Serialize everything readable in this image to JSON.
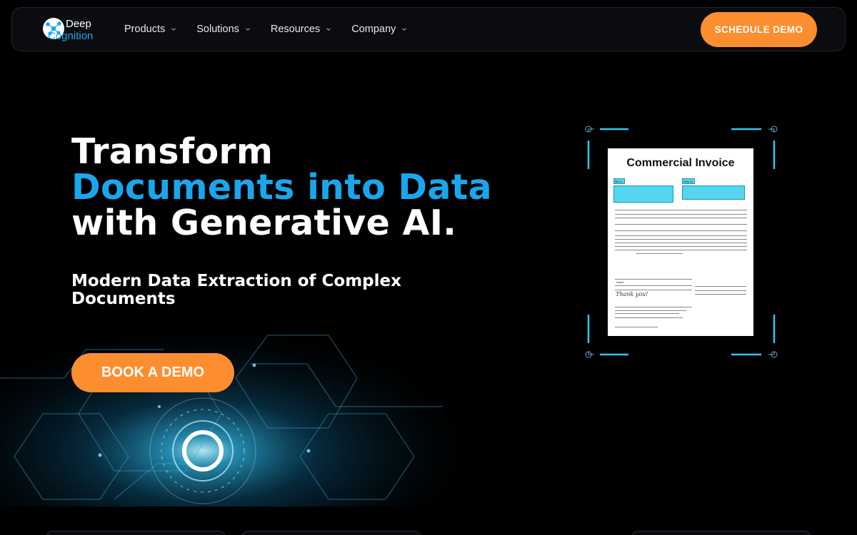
{
  "brand": {
    "name_line1": "Deep",
    "name_line2": "Cognition"
  },
  "nav": {
    "items": [
      {
        "label": "Products"
      },
      {
        "label": "Solutions"
      },
      {
        "label": "Resources"
      },
      {
        "label": "Company"
      }
    ],
    "cta": "SCHEDULE DEMO"
  },
  "hero": {
    "line1": "Transform",
    "line2": "Documents into Data",
    "line3": "with Generative AI.",
    "subtitle": "Modern Data Extraction of Complex Documents",
    "cta": "BOOK A DEMO"
  },
  "invoice": {
    "title": "Commercial Invoice",
    "bill_to": "Bill To",
    "ship_to": "Ship To",
    "thanks": "Thank you!",
    "notes": "Notes"
  },
  "colors": {
    "accent": "#1aa6ec",
    "cta": "#fd8e2f",
    "background": "#000000"
  }
}
